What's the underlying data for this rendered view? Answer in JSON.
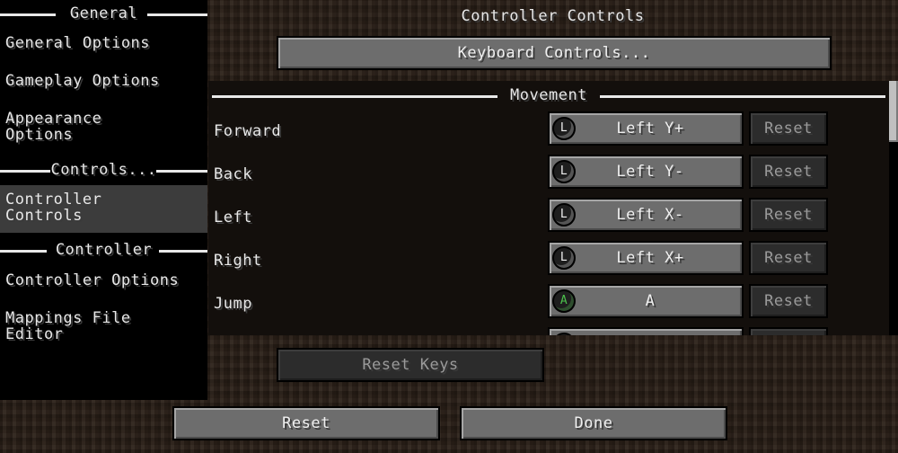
{
  "sidebar": {
    "sections": [
      {
        "header": "General",
        "items": [
          "General Options",
          "Gameplay Options",
          "Appearance Options"
        ]
      },
      {
        "header": "Controls...",
        "items": [
          "Controller Controls"
        ]
      },
      {
        "header": "Controller",
        "items": [
          "Controller Options",
          "Mappings File Editor"
        ]
      }
    ],
    "selected_item": "Controller Controls"
  },
  "header": {
    "title": "Controller Controls",
    "keyboard_button": "Keyboard Controls..."
  },
  "list": {
    "section": "Movement",
    "rows": [
      {
        "label": "Forward",
        "icon": "left-stick-icon",
        "icon_glyph": "L",
        "binding": "Left Y+",
        "reset": "Reset"
      },
      {
        "label": "Back",
        "icon": "left-stick-icon",
        "icon_glyph": "L",
        "binding": "Left Y-",
        "reset": "Reset"
      },
      {
        "label": "Left",
        "icon": "left-stick-icon",
        "icon_glyph": "L",
        "binding": "Left X-",
        "reset": "Reset"
      },
      {
        "label": "Right",
        "icon": "left-stick-icon",
        "icon_glyph": "L",
        "binding": "Left X+",
        "reset": "Reset"
      },
      {
        "label": "Jump",
        "icon": "a-button-icon",
        "icon_glyph": "A",
        "binding": "A",
        "reset": "Reset"
      }
    ]
  },
  "footer": {
    "reset_keys": "Reset Keys",
    "reset": "Reset",
    "done": "Done"
  },
  "colors": {
    "a_button_green": "#4cc24c",
    "selected_item_bg": "#3c3c3c"
  }
}
